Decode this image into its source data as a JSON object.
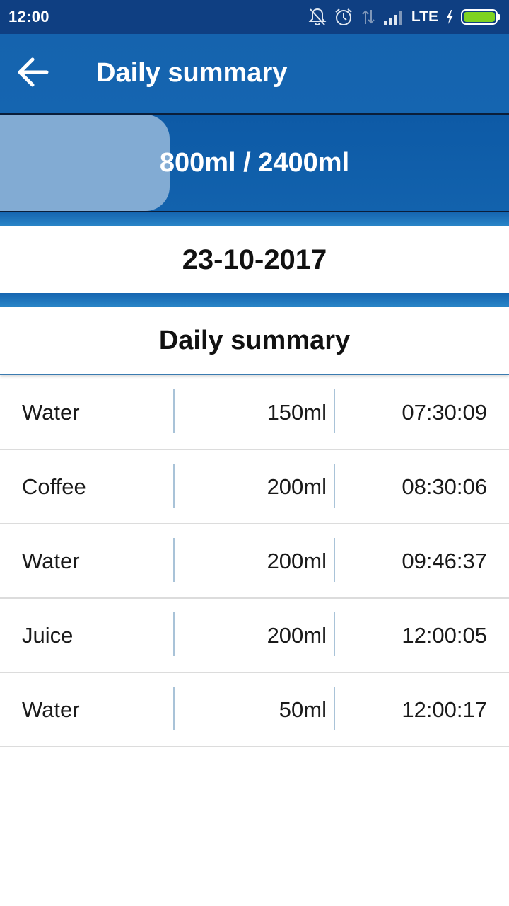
{
  "status_bar": {
    "time": "12:00",
    "network": "LTE",
    "icons": [
      "bell-muted-icon",
      "alarm-icon",
      "data-arrows-icon",
      "signal-icon",
      "charging-icon",
      "battery-icon"
    ]
  },
  "app_bar": {
    "title": "Daily summary",
    "back_icon": "arrow-left-icon"
  },
  "progress": {
    "label": "800ml / 2400ml",
    "consumed_ml": 800,
    "goal_ml": 2400,
    "fraction": 0.333,
    "fill_color": "#82abd3"
  },
  "date": "23-10-2017",
  "summary": {
    "title": "Daily summary",
    "entries": [
      {
        "type": "Water",
        "amount": "150ml",
        "time": "07:30:09"
      },
      {
        "type": "Coffee",
        "amount": "200ml",
        "time": "08:30:06"
      },
      {
        "type": "Water",
        "amount": "200ml",
        "time": "09:46:37"
      },
      {
        "type": "Juice",
        "amount": "200ml",
        "time": "12:00:05"
      },
      {
        "type": "Water",
        "amount": "50ml",
        "time": "12:00:17"
      }
    ]
  },
  "colors": {
    "status_bar": "#0f3f82",
    "app_bar": "#1565b0",
    "accent": "#2a86c8",
    "battery": "#7ed321"
  }
}
